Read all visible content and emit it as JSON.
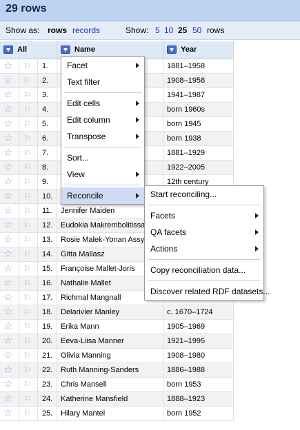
{
  "header": {
    "title": "29 rows"
  },
  "viewbar": {
    "show_as_label": "Show as:",
    "mode_rows": "rows",
    "mode_records": "records",
    "show_label": "Show:",
    "page_sizes": [
      "5",
      "10",
      "25",
      "50"
    ],
    "rows_suffix": "rows"
  },
  "columns": {
    "all": "All",
    "name": "Name",
    "year": "Year"
  },
  "rows": [
    {
      "n": "1.",
      "name": "",
      "year": "1881–1958"
    },
    {
      "n": "2.",
      "name": "",
      "year": "1908–1958"
    },
    {
      "n": "3.",
      "name": "",
      "year": "1941–1987"
    },
    {
      "n": "4.",
      "name": "",
      "year": "born 1960s"
    },
    {
      "n": "5.",
      "name": "",
      "year": "born 1945"
    },
    {
      "n": "6.",
      "name": "",
      "year": "born 1938"
    },
    {
      "n": "7.",
      "name": "",
      "year": "1881–1929"
    },
    {
      "n": "8.",
      "name": "",
      "year": "1922–2005"
    },
    {
      "n": "9.",
      "name": "",
      "year": "12th century"
    },
    {
      "n": "10.",
      "name": "",
      "year": ""
    },
    {
      "n": "11.",
      "name": "Jennifer Maiden",
      "year": ""
    },
    {
      "n": "12.",
      "name": "Eudokia Makrembolitissa",
      "year": ""
    },
    {
      "n": "13.",
      "name": "Rosie Malek-Yonan Assyrian",
      "year": ""
    },
    {
      "n": "14.",
      "name": "Gitta Mallasz",
      "year": ""
    },
    {
      "n": "15.",
      "name": "Françoise Mallet-Joris",
      "year": ""
    },
    {
      "n": "16.",
      "name": "Nathalie Mallet",
      "year": ""
    },
    {
      "n": "17.",
      "name": "Richmal Mangnall",
      "year": ""
    },
    {
      "n": "18.",
      "name": "Delarivier Manley",
      "year": "c. 1670–1724"
    },
    {
      "n": "19.",
      "name": "Erika Mann",
      "year": "1905–1969"
    },
    {
      "n": "20.",
      "name": "Eeva-Liisa Manner",
      "year": "1921–1995"
    },
    {
      "n": "21.",
      "name": "Olivia Manning",
      "year": "1908–1980"
    },
    {
      "n": "22.",
      "name": "Ruth Manning-Sanders",
      "year": "1886–1988"
    },
    {
      "n": "23.",
      "name": "Chris Mansell",
      "year": "born 1953"
    },
    {
      "n": "24.",
      "name": "Katherine Mansfield",
      "year": "1888–1923"
    },
    {
      "n": "25.",
      "name": "Hilary Mantel",
      "year": "born 1952"
    }
  ],
  "column_menu": {
    "facet": "Facet",
    "text_filter": "Text filter",
    "edit_cells": "Edit cells",
    "edit_column": "Edit column",
    "transpose": "Transpose",
    "sort": "Sort...",
    "view": "View",
    "reconcile": "Reconcile"
  },
  "reconcile_menu": {
    "start": "Start reconciling...",
    "facets": "Facets",
    "qa_facets": "QA facets",
    "actions": "Actions",
    "copy_data": "Copy reconciliation data...",
    "discover": "Discover related RDF datasets..."
  },
  "icons": {
    "star": "star-icon",
    "flag": "flag-icon",
    "dropdown": "dropdown-icon",
    "submenu": "submenu-arrow-icon"
  },
  "colors": {
    "header_bg": "#bcd3f2",
    "link": "#1a2eb7",
    "menu_selected": "#cfdcf3"
  }
}
